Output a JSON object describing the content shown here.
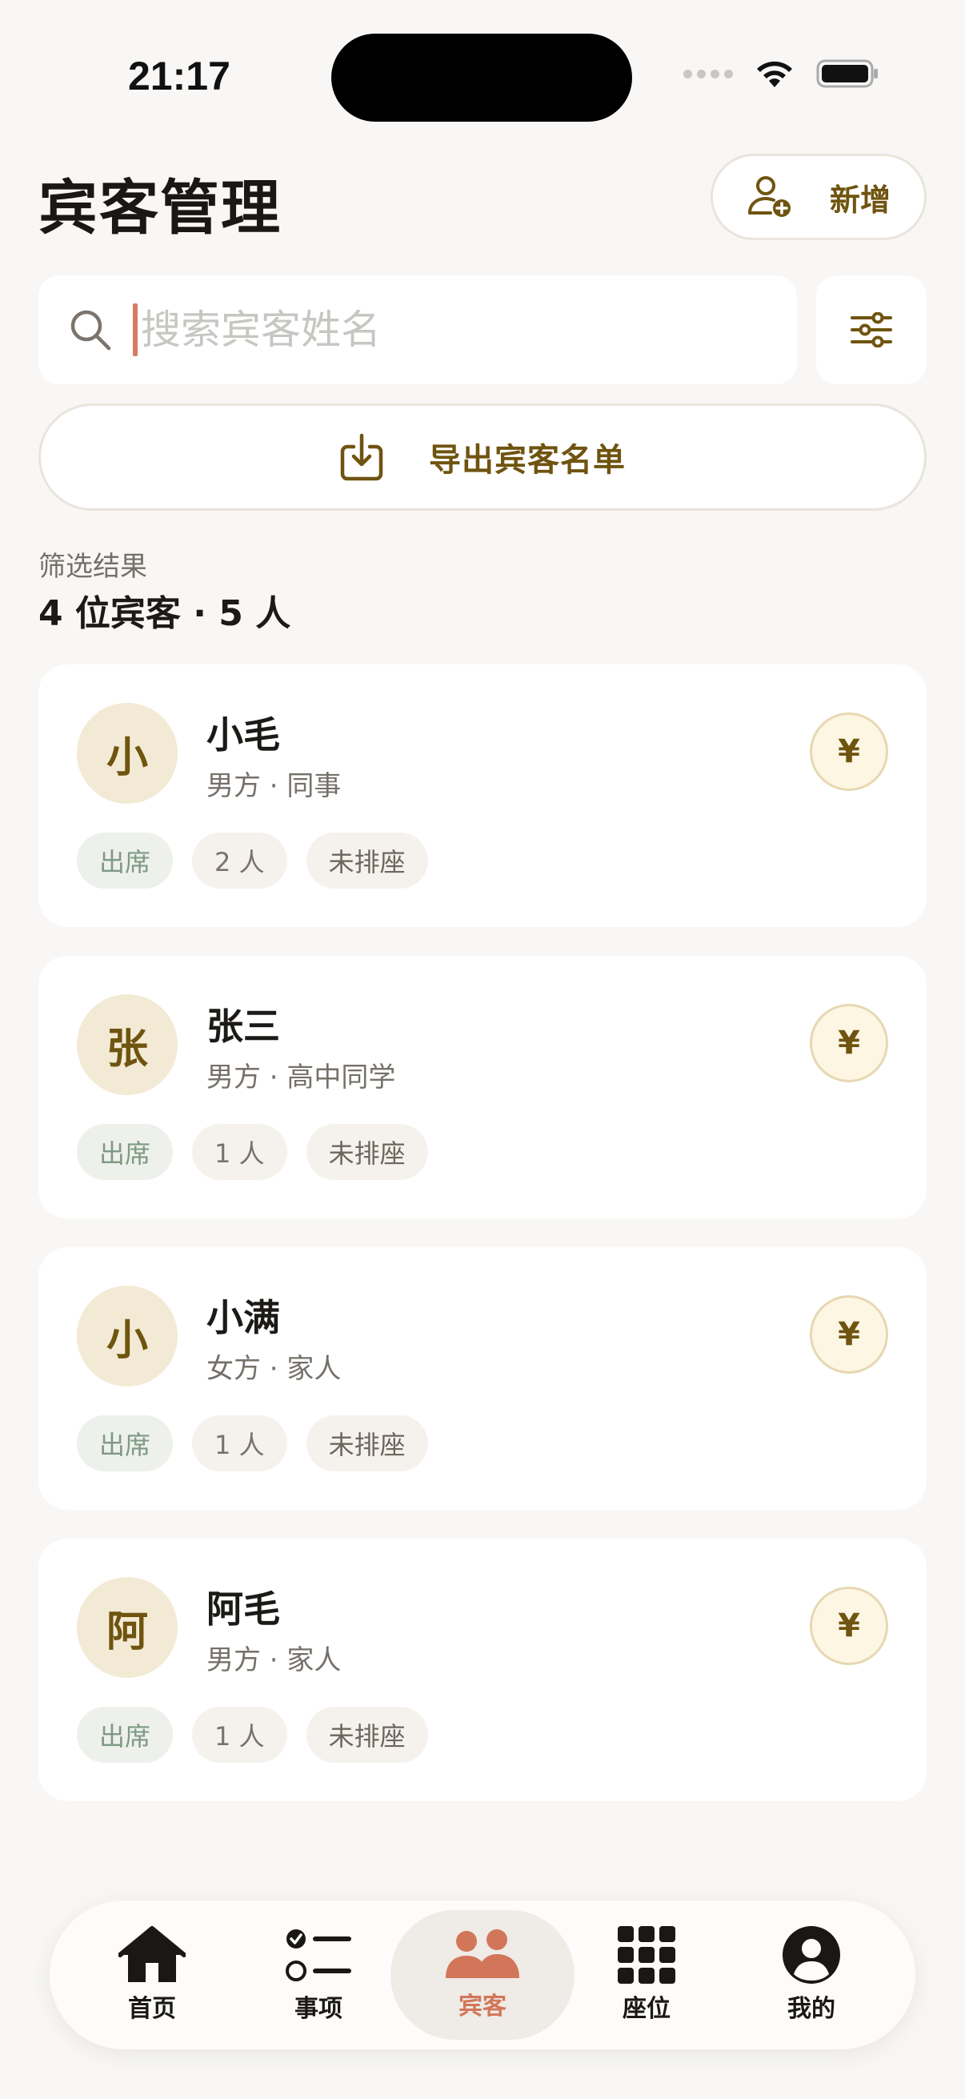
{
  "status_bar": {
    "time": "21:17"
  },
  "header": {
    "title": "宾客管理",
    "add_label": "新增"
  },
  "search": {
    "placeholder": "搜索宾客姓名"
  },
  "export": {
    "label": "导出宾客名单"
  },
  "results": {
    "caption": "筛选结果",
    "count": "4 位宾客 · 5 人"
  },
  "guests": [
    {
      "initial": "小",
      "name": "小毛",
      "meta": "男方 · 同事",
      "status": "出席",
      "count": "2 人",
      "seat": "未排座",
      "gift": "¥"
    },
    {
      "initial": "张",
      "name": "张三",
      "meta": "男方 · 高中同学",
      "status": "出席",
      "count": "1 人",
      "seat": "未排座",
      "gift": "¥"
    },
    {
      "initial": "小",
      "name": "小满",
      "meta": "女方 · 家人",
      "status": "出席",
      "count": "1 人",
      "seat": "未排座",
      "gift": "¥"
    },
    {
      "initial": "阿",
      "name": "阿毛",
      "meta": "男方 · 家人",
      "status": "出席",
      "count": "1 人",
      "seat": "未排座",
      "gift": "¥"
    }
  ],
  "nav": {
    "items": [
      {
        "label": "首页",
        "icon": "home-icon"
      },
      {
        "label": "事项",
        "icon": "checklist-icon"
      },
      {
        "label": "宾客",
        "icon": "guests-icon",
        "active": true
      },
      {
        "label": "座位",
        "icon": "grid-icon"
      },
      {
        "label": "我的",
        "icon": "profile-icon"
      }
    ]
  },
  "colors": {
    "accent": "#6f5410",
    "active_tab": "#d2765a",
    "background": "#f8f7f5"
  }
}
